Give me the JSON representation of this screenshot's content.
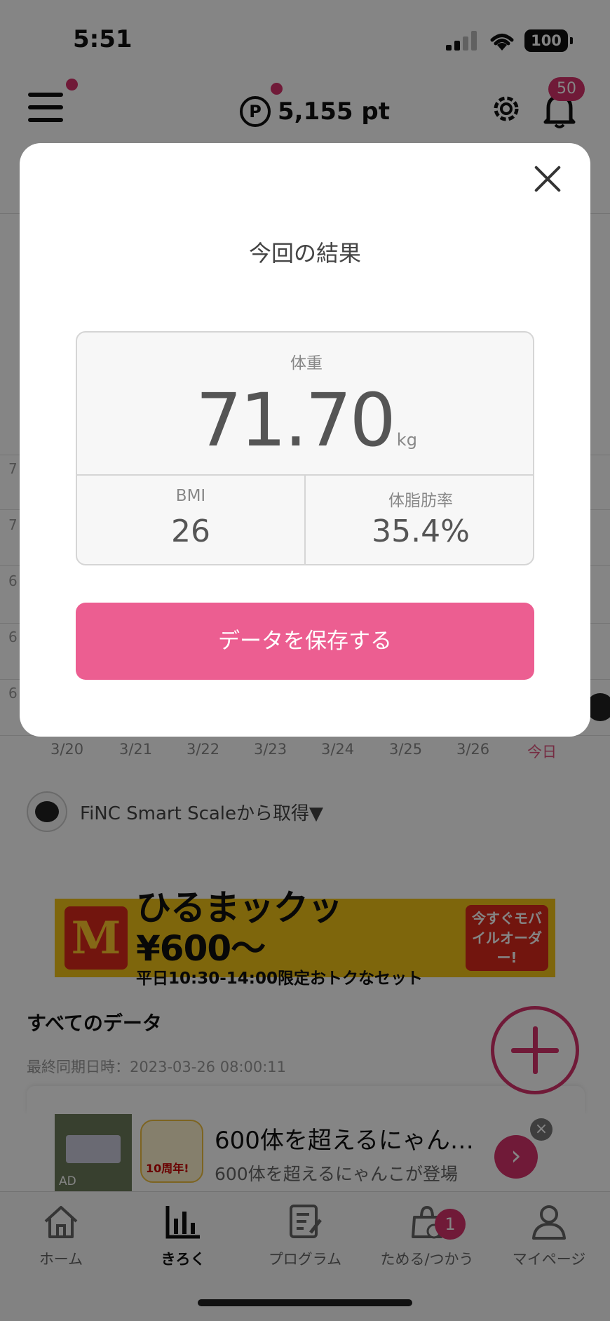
{
  "status_bar": {
    "time": "5:51",
    "battery": "100"
  },
  "header": {
    "points": "5,155 pt",
    "points_symbol": "P",
    "notification_count": "50"
  },
  "chart": {
    "y_labels": [
      "7",
      "7",
      "6",
      "6",
      "6"
    ],
    "dates": [
      "3/20",
      "3/21",
      "3/22",
      "3/23",
      "3/24",
      "3/25",
      "3/26",
      "今日"
    ]
  },
  "scale_source": "FiNC Smart Scaleから取得▼",
  "mc_banner": {
    "logo": "M",
    "headline": "ひるまックッ¥600〜",
    "subline": "平日10:30-14:00限定おトクなセット",
    "order_label": "今すぐモバイルオーダー!"
  },
  "data_section": {
    "title": "すべてのデータ",
    "sync_time": "最終同期日時：2023-03-26 08:00:11"
  },
  "ad": {
    "badge": "AD",
    "icon_text": "10周年!",
    "title": "600体を超えるにゃん…",
    "subtitle": "600体を超えるにゃんこが登場",
    "arrow": "›",
    "close": "×"
  },
  "tabs": [
    {
      "label": "ホーム",
      "icon": "home-icon"
    },
    {
      "label": "きろく",
      "icon": "chart-icon",
      "active": true
    },
    {
      "label": "プログラム",
      "icon": "program-icon"
    },
    {
      "label": "ためる/つかう",
      "icon": "points-bag-icon",
      "badge": "1"
    },
    {
      "label": "マイページ",
      "icon": "person-icon"
    }
  ],
  "modal": {
    "title": "今回の結果",
    "weight_label": "体重",
    "weight_value": "71.70",
    "weight_unit": "kg",
    "bmi_label": "BMI",
    "bmi_value": "26",
    "bodyfat_label": "体脂肪率",
    "bodyfat_value": "35.4%",
    "save_button": "データを保存する"
  },
  "colors": {
    "accent": "#d6336c",
    "save_button": "#ec5e91",
    "today": "#e0557f"
  }
}
